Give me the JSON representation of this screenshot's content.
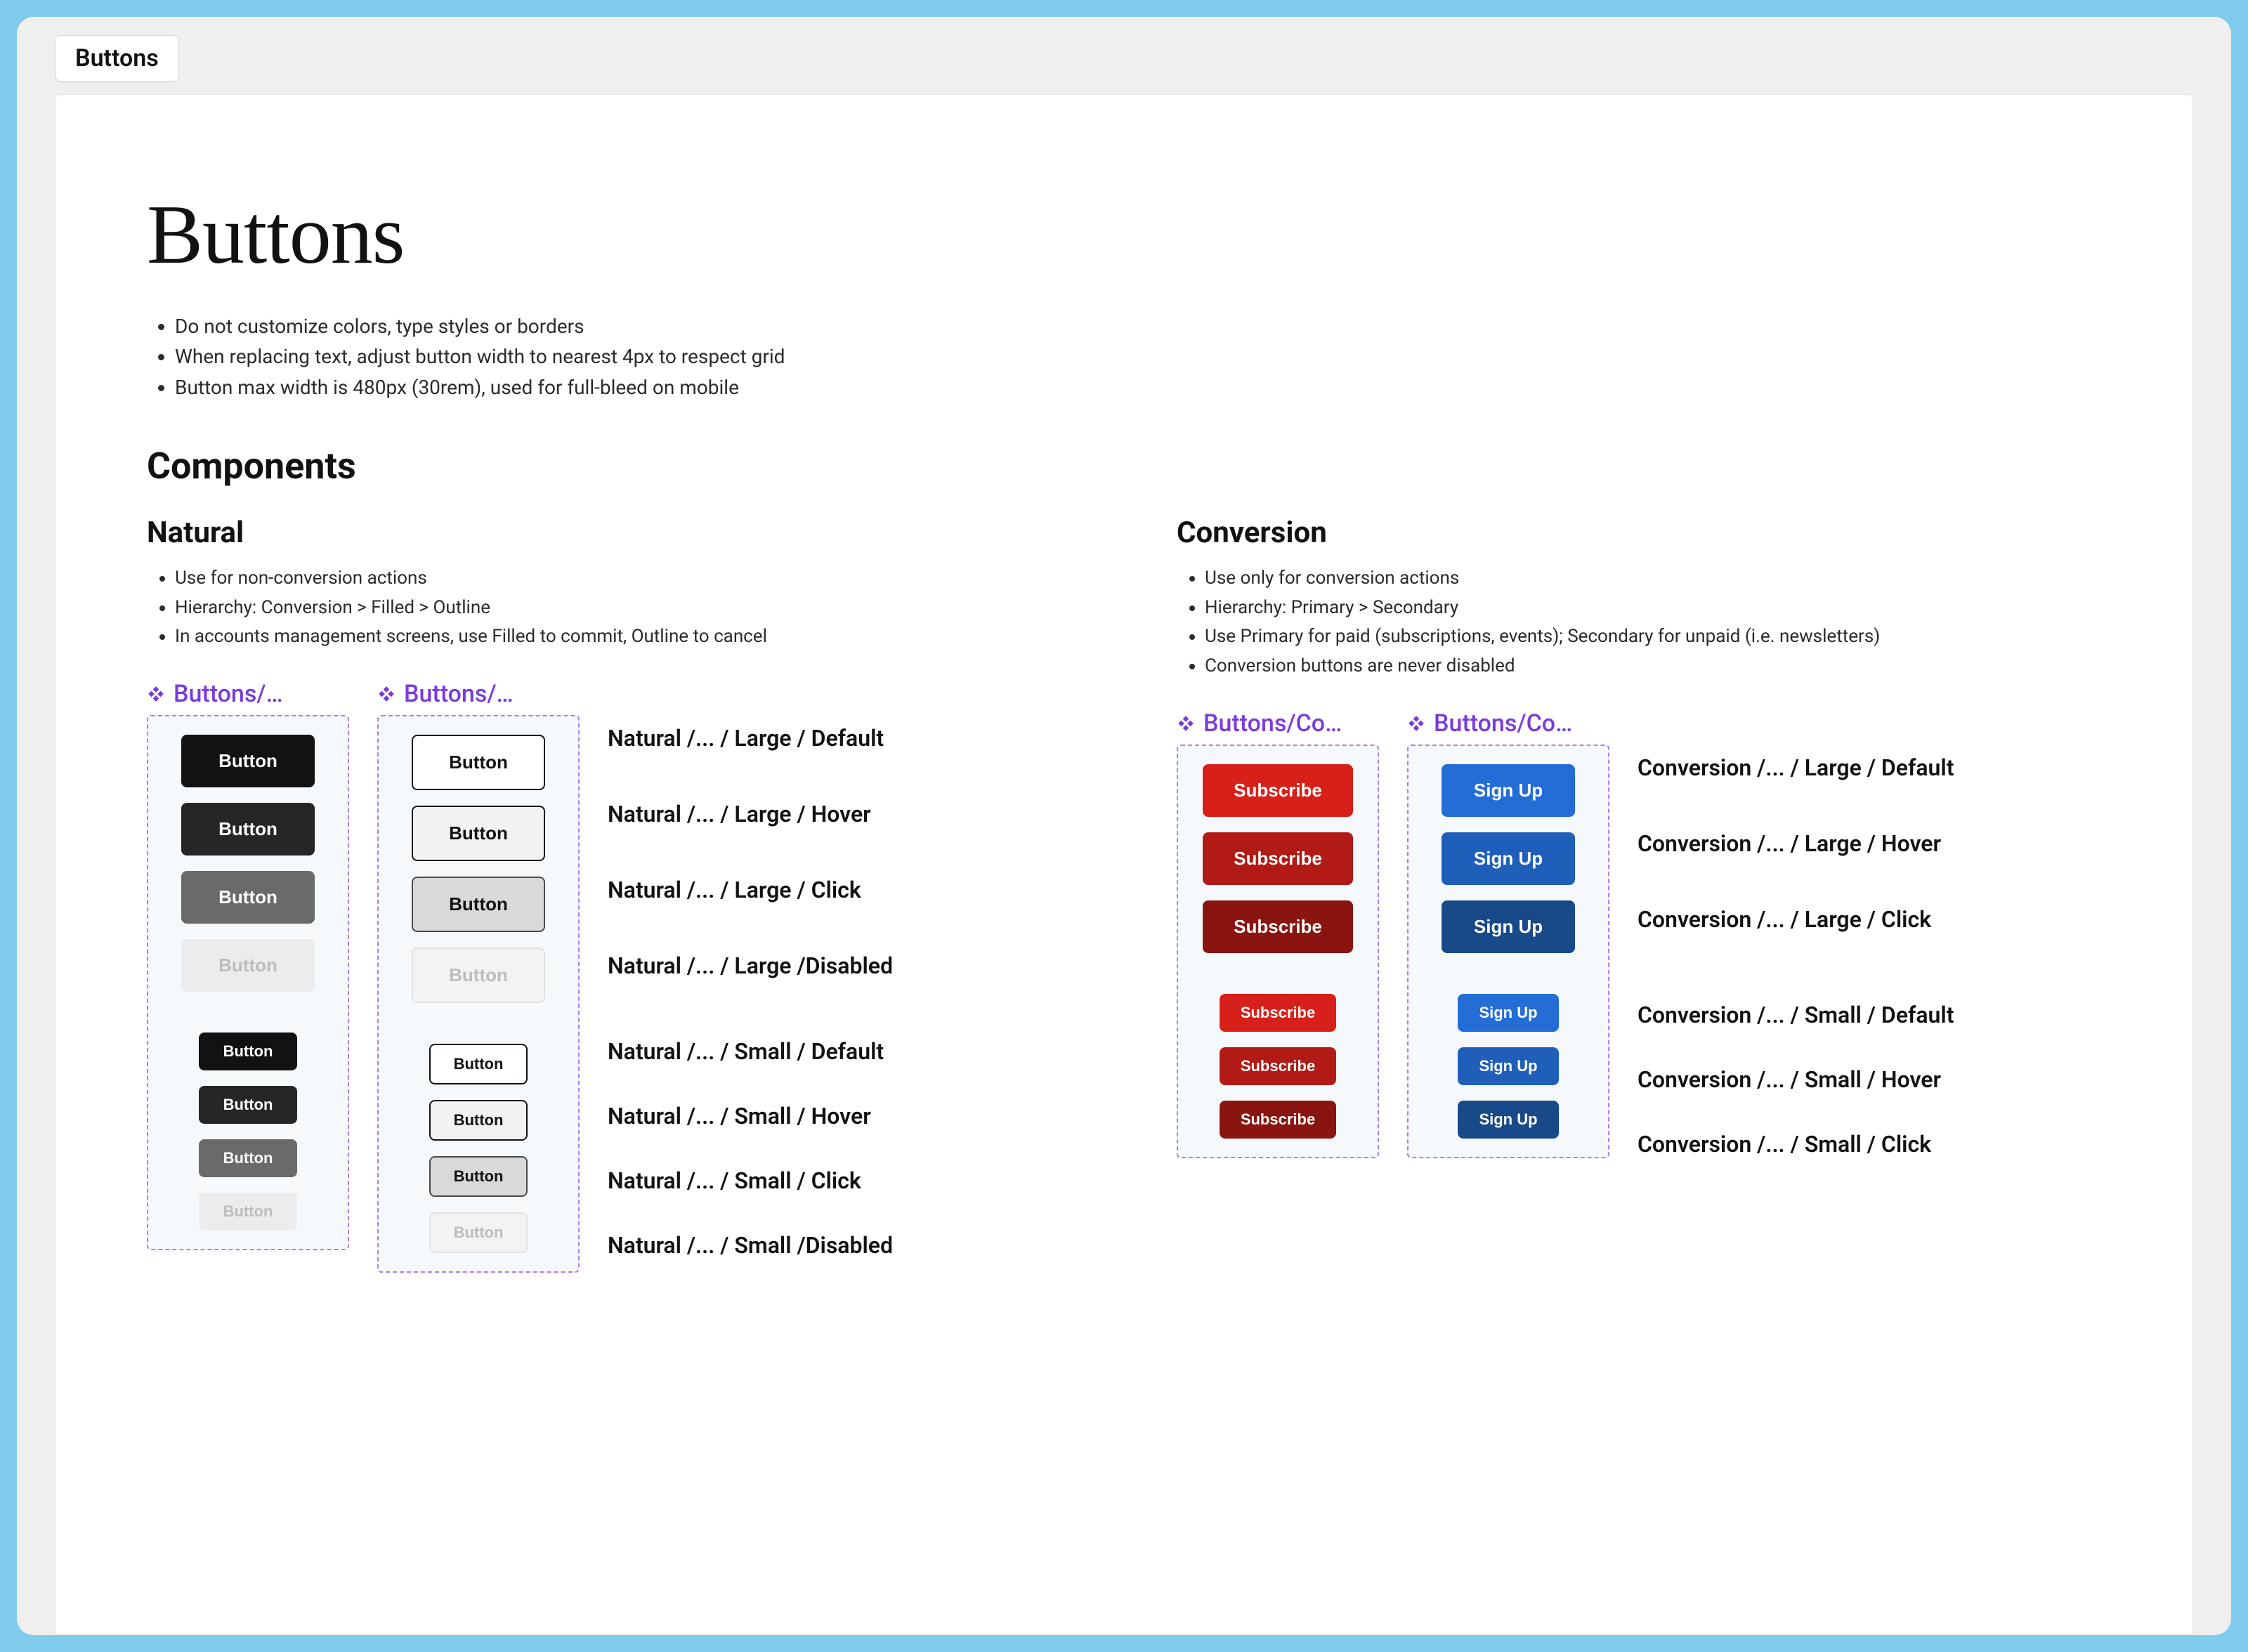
{
  "tab": "Buttons",
  "title": "Buttons",
  "guidelines": [
    "Do not customize colors, type styles or borders",
    "When replacing text, adjust button width to nearest 4px to respect grid",
    "Button max width is 480px (30rem), used for full-bleed on mobile"
  ],
  "components_heading": "Components",
  "natural": {
    "heading": "Natural",
    "notes": [
      "Use for non-conversion actions",
      "Hierarchy: Conversion > Filled > Outline",
      "In accounts management screens, use Filled to commit, Outline to cancel"
    ],
    "tile_label_filled": "Buttons/…",
    "tile_label_outline": "Buttons/…",
    "button_text": "Button",
    "states_large": [
      "Natural /... / Large / Default",
      "Natural /... /  Large / Hover",
      "Natural /... / Large / Click",
      "Natural /... /  Large /Disabled"
    ],
    "states_small": [
      "Natural /... /  Small / Default",
      "Natural /... /  Small / Hover",
      "Natural /... / Small / Click",
      "Natural /... / Small /Disabled"
    ]
  },
  "conversion": {
    "heading": "Conversion",
    "notes": [
      "Use only for conversion actions",
      "Hierarchy: Primary > Secondary",
      "Use Primary for paid (subscriptions, events); Secondary for unpaid (i.e. newsletters)",
      "Conversion buttons are never disabled"
    ],
    "tile_label_primary": "Buttons/Co…",
    "tile_label_secondary": "Buttons/Co…",
    "primary_text": "Subscribe",
    "secondary_text": "Sign Up",
    "states_large": [
      "Conversion /... / Large / Default",
      "Conversion /... / Large / Hover",
      "Conversion /...  / Large / Click"
    ],
    "states_small": [
      "Conversion /... / Small / Default",
      "Conversion /... / Small / Hover",
      "Conversion /... / Small / Click"
    ]
  },
  "colors": {
    "purple": "#7a3bdc",
    "red_default": "#d8201a",
    "red_hover": "#b11a15",
    "red_click": "#8a140f",
    "blue_default": "#246dd6",
    "blue_hover": "#1f5fb9",
    "blue_click": "#184988",
    "filled_default": "#121212",
    "filled_hover": "#262626",
    "filled_click": "#6a6a6a",
    "filled_disabled": "#ececec"
  }
}
